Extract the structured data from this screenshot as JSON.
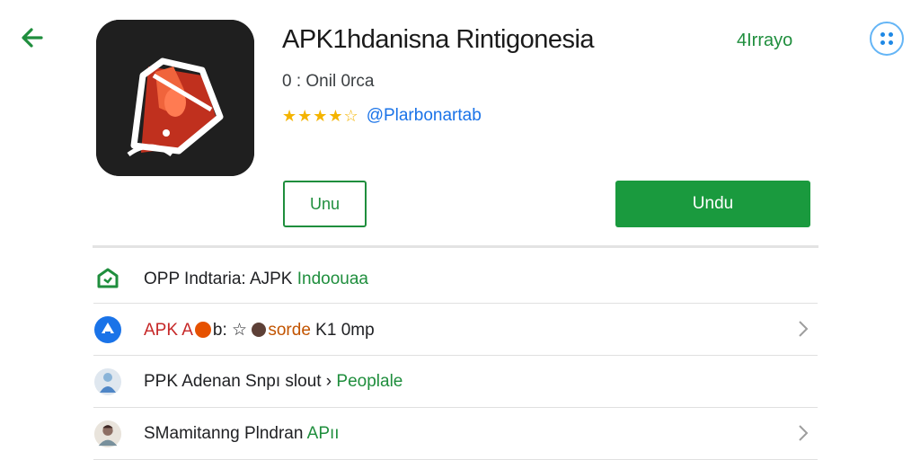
{
  "header": {
    "back_icon": "arrow-left-icon",
    "title": "APK1hdanisna Rintigonesia",
    "link": "4Irrayo",
    "more_icon": "more-dots-icon",
    "accent": "#1f8e3d"
  },
  "app": {
    "icon": "app-logo-icon",
    "meta": "0 : Onil 0rca",
    "stars": "★★★★☆",
    "rating_value": 4.5,
    "developer": "@Plarbonartab"
  },
  "actions": {
    "secondary_label": "Unu",
    "primary_label": "Undu",
    "primary_color": "#1a9a3e"
  },
  "rows": [
    {
      "icon": "shield-icon",
      "text_a": "OPP Indtaria: AJPK ",
      "text_b": "Indoouaa",
      "chevron": false
    },
    {
      "icon": "store-icon",
      "text_a": "APK A",
      "text_mid": "b: ☆ ",
      "text_b": "sorde",
      "text_c": " K1 0mp",
      "chevron": true
    },
    {
      "icon": "avatar-icon",
      "text_a": "PPK Adenan Snpı slout › ",
      "text_b": "Peoplale",
      "chevron": false
    },
    {
      "icon": "person-avatar-icon",
      "text_a": "SMamitanng Plndran ",
      "text_b": "APıı",
      "chevron": true
    }
  ]
}
